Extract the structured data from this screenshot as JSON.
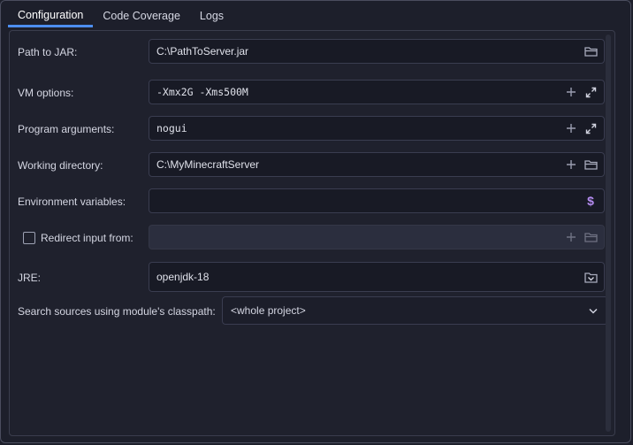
{
  "tabs": [
    {
      "label": "Configuration",
      "active": true
    },
    {
      "label": "Code Coverage",
      "active": false
    },
    {
      "label": "Logs",
      "active": false
    }
  ],
  "form": {
    "path_to_jar": {
      "label": "Path to JAR:",
      "value": "C:\\PathToServer.jar"
    },
    "vm_options": {
      "label": "VM options:",
      "value": "-Xmx2G -Xms500M"
    },
    "program_arguments": {
      "label": "Program arguments:",
      "value": "nogui"
    },
    "working_directory": {
      "label": "Working directory:",
      "value": "C:\\MyMinecraftServer"
    },
    "environment_variables": {
      "label": "Environment variables:",
      "value": ""
    },
    "redirect_input": {
      "label": "Redirect input from:",
      "checked": false,
      "value": ""
    },
    "jre": {
      "label": "JRE:",
      "value": "openjdk-18"
    },
    "search_sources": {
      "label": "Search sources using module's classpath:",
      "value": "<whole project>"
    }
  },
  "colors": {
    "accent": "#4d8ef0",
    "background": "#1d1f2b",
    "field_background": "#181a25",
    "env_icon": "#b48cf0"
  },
  "icons": {
    "folder": "folder-icon",
    "plus": "plus-icon",
    "expand": "expand-icon",
    "dollar": "dollar-icon",
    "chevron": "chevron-down-icon"
  }
}
